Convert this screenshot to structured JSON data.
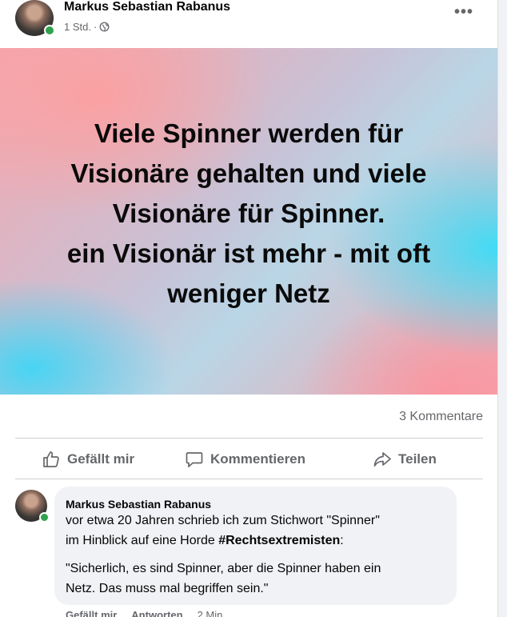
{
  "post": {
    "author": "Markus Sebastian Rabanus",
    "time": "1 Std.",
    "separator": "·",
    "banner_lines": [
      "Viele Spinner werden für",
      "Visionäre gehalten und viele",
      "Visionäre für Spinner.",
      "ein Visionär ist mehr - mit oft",
      "weniger Netz"
    ],
    "comments_count": "3 Kommentare"
  },
  "actions": {
    "like": "Gefällt mir",
    "comment": "Kommentieren",
    "share": "Teilen"
  },
  "comment": {
    "author": "Markus Sebastian Rabanus",
    "line1": "vor etwa 20 Jahren schrieb ich zum Stichwort \"Spinner\"",
    "line2_prefix": "im Hinblick auf eine Horde ",
    "hashtag": "#Rechtsextremisten",
    "line2_suffix": ":",
    "quote1": "\"Sicherlich, es sind Spinner, aber die Spinner haben ein",
    "quote2": "Netz. Das muss mal begriffen sein.\"",
    "like": "Gefällt mir",
    "reply": "Antworten",
    "time": "2 Min."
  },
  "colors": {
    "online": "#31a24c",
    "secondary_text": "#65676b",
    "bubble": "#f0f2f5"
  },
  "icons": [
    "globe-icon",
    "more-icon",
    "thumbs-up-icon",
    "comment-icon",
    "share-icon"
  ]
}
